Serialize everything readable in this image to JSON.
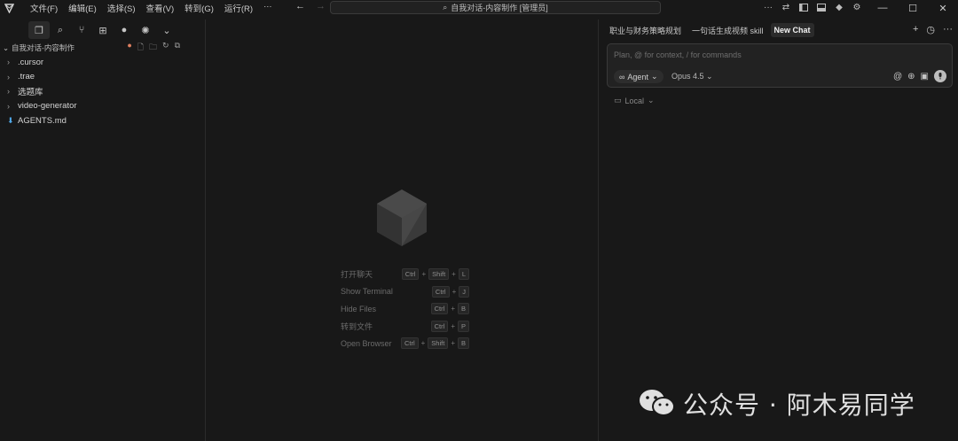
{
  "menu": [
    "文件(F)",
    "编辑(E)",
    "选择(S)",
    "查看(V)",
    "转到(G)",
    "运行(R)",
    "···"
  ],
  "command_center": {
    "text": "自我对话-内容制作 [管理员]"
  },
  "window_controls": {
    "more": "···",
    "minimize": "—",
    "maximize": "☐",
    "close": "✕"
  },
  "explorer": {
    "root": "自我对话-内容制作",
    "items": [
      {
        "label": ".cursor",
        "type": "folder"
      },
      {
        "label": ".trae",
        "type": "folder"
      },
      {
        "label": "选题库",
        "type": "folder"
      },
      {
        "label": "video-generator",
        "type": "folder"
      },
      {
        "label": "AGENTS.md",
        "type": "file"
      }
    ]
  },
  "shortcuts": [
    {
      "label": "打开聊天",
      "keys": [
        "Ctrl",
        "Shift",
        "L"
      ]
    },
    {
      "label": "Show Terminal",
      "keys": [
        "Ctrl",
        "J"
      ]
    },
    {
      "label": "Hide Files",
      "keys": [
        "Ctrl",
        "B"
      ]
    },
    {
      "label": "转到文件",
      "keys": [
        "Ctrl",
        "P"
      ]
    },
    {
      "label": "Open Browser",
      "keys": [
        "Ctrl",
        "Shift",
        "B"
      ]
    }
  ],
  "chat": {
    "tabs": [
      "职业与财务策略规划",
      "一句话生成视频 skill",
      "New Chat"
    ],
    "active_tab": "New Chat",
    "placeholder": "Plan, @ for context, / for commands",
    "agent_label": "Agent",
    "model_label": "Opus 4.5",
    "local_label": "Local"
  },
  "watermark": {
    "text": "公众号 · 阿木易同学"
  },
  "colors": {
    "background": "#181818",
    "border": "#2b2b2b",
    "text": "#cccccc",
    "md_icon": "#4fa8e8"
  }
}
